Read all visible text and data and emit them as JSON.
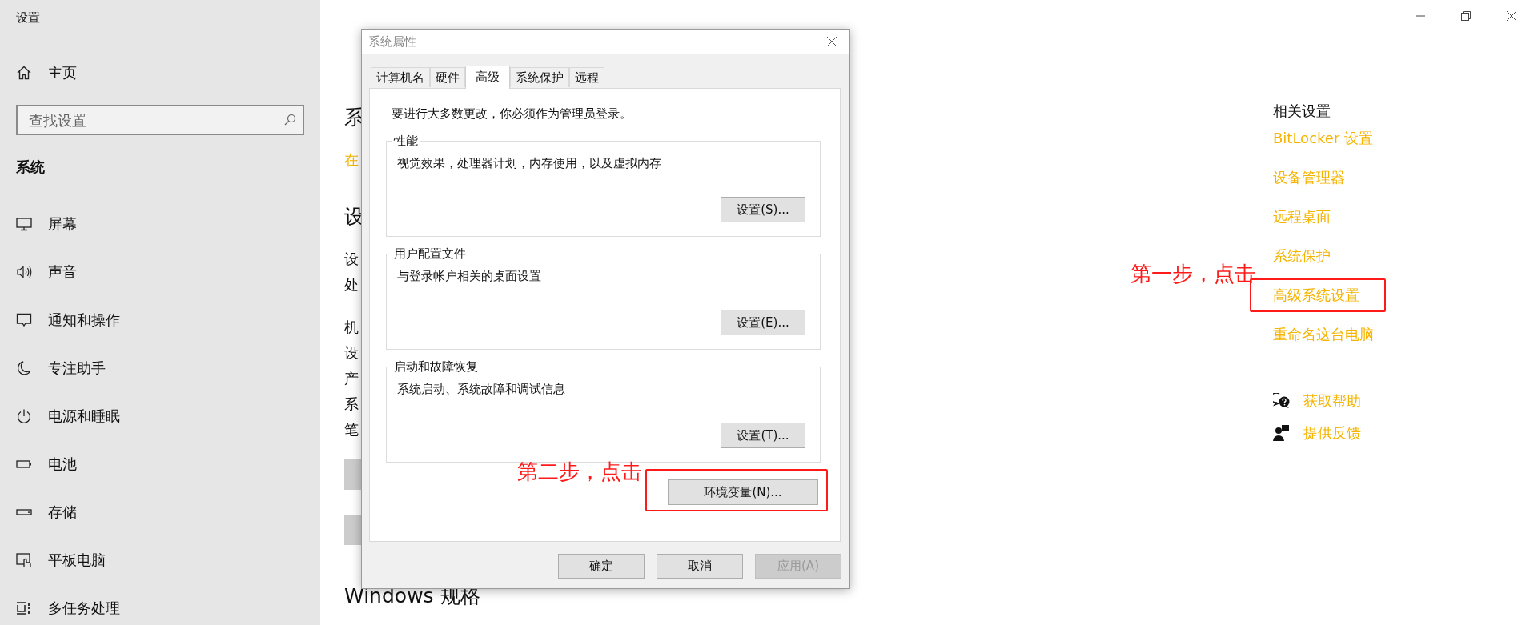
{
  "window": {
    "title": "设置"
  },
  "sidebar": {
    "home": "主页",
    "search": {
      "placeholder": "查找设置"
    },
    "section": "系统",
    "items": [
      {
        "label": "屏幕"
      },
      {
        "label": "声音"
      },
      {
        "label": "通知和操作"
      },
      {
        "label": "专注助手"
      },
      {
        "label": "电源和睡眠"
      },
      {
        "label": "电池"
      },
      {
        "label": "存储"
      },
      {
        "label": "平板电脑"
      },
      {
        "label": "多任务处理"
      }
    ]
  },
  "main": {
    "items": [
      {
        "kind": "section",
        "text": "系"
      },
      {
        "kind": "link",
        "text": "在"
      },
      {
        "kind": "section",
        "text": "设"
      },
      {
        "kind": "paragraph",
        "lines": [
          "设",
          "处"
        ]
      },
      {
        "kind": "paragraph",
        "lines": [
          "机",
          "设",
          "产",
          "系",
          "笔"
        ]
      },
      {
        "kind": "button"
      },
      {
        "kind": "button"
      },
      {
        "kind": "section",
        "text": "Windows 规格"
      }
    ]
  },
  "related": {
    "heading": "相关设置",
    "links": [
      {
        "label": "BitLocker 设置",
        "highlighted": false
      },
      {
        "label": "设备管理器",
        "highlighted": false
      },
      {
        "label": "远程桌面",
        "highlighted": false
      },
      {
        "label": "系统保护",
        "highlighted": false
      },
      {
        "label": "高级系统设置",
        "highlighted": true,
        "note": "第一步，点击"
      },
      {
        "label": "重命名这台电脑",
        "highlighted": false
      }
    ],
    "support": [
      {
        "label": "获取帮助"
      },
      {
        "label": "提供反馈"
      }
    ]
  },
  "dialog": {
    "title": "系统属性",
    "tabs": [
      {
        "label": "计算机名",
        "selected": false
      },
      {
        "label": "硬件",
        "selected": false
      },
      {
        "label": "高级",
        "selected": true
      },
      {
        "label": "系统保护",
        "selected": false
      },
      {
        "label": "远程",
        "selected": false
      }
    ],
    "notice": "要进行大多数更改，你必须作为管理员登录。",
    "groups": [
      {
        "title": "性能",
        "description": "视觉效果，处理器计划，内存使用，以及虚拟内存",
        "button": "设置(S)..."
      },
      {
        "title": "用户配置文件",
        "description": "与登录帐户相关的桌面设置",
        "button": "设置(E)..."
      },
      {
        "title": "启动和故障恢复",
        "description": "系统启动、系统故障和调试信息",
        "button": "设置(T)..."
      }
    ],
    "env_button": {
      "label": "环境变量(N)...",
      "highlighted": true,
      "note": "第二步，点击"
    },
    "buttons": [
      {
        "label": "确定",
        "disabled": false
      },
      {
        "label": "取消",
        "disabled": false
      },
      {
        "label": "应用(A)",
        "disabled": true
      }
    ]
  }
}
